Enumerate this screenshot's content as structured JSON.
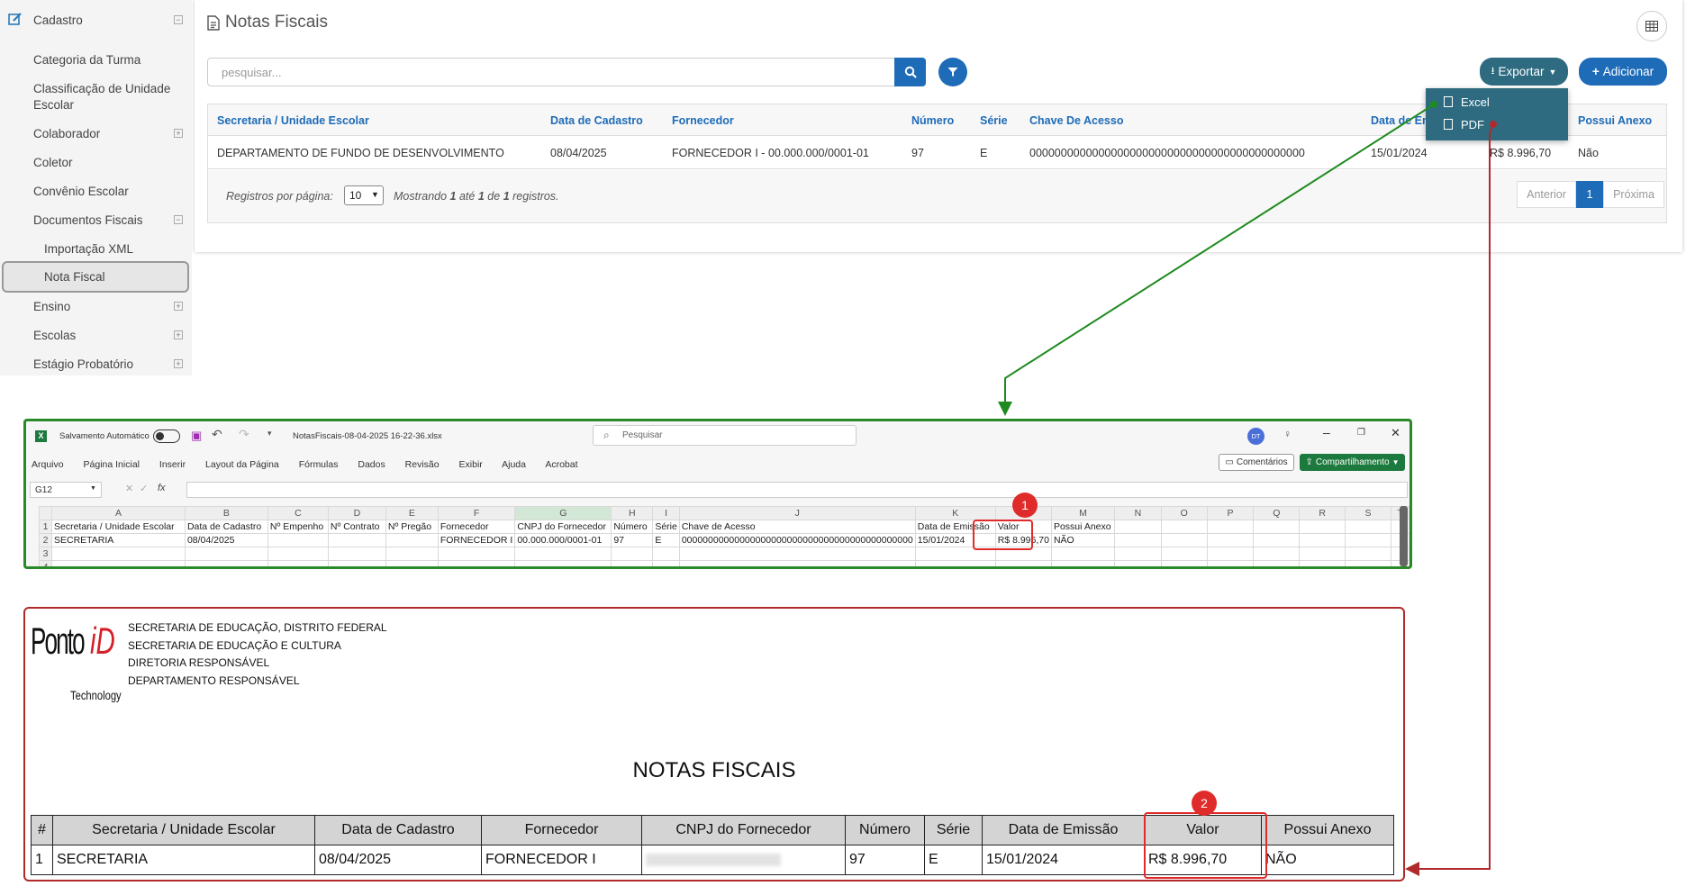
{
  "sidebar": {
    "header": "Cadastro",
    "items": [
      {
        "label": "Categoria da Turma"
      },
      {
        "label": "Classificação de Unidade"
      },
      {
        "label": "Escolar"
      },
      {
        "label": "Colaborador"
      },
      {
        "label": "Coletor"
      },
      {
        "label": "Convênio Escolar"
      },
      {
        "label": "Documentos Fiscais"
      },
      {
        "label": "Importação XML"
      },
      {
        "label": "Nota Fiscal"
      },
      {
        "label": "Ensino"
      },
      {
        "label": "Escolas"
      },
      {
        "label": "Estágio Probatório"
      }
    ]
  },
  "page": {
    "title": "Notas Fiscais",
    "search_placeholder": "pesquisar...",
    "export_label": "Exportar",
    "add_label": "Adicionar",
    "export_menu": [
      "Excel",
      "PDF"
    ]
  },
  "table": {
    "headers": [
      "Secretaria / Unidade Escolar",
      "Data de Cadastro",
      "Fornecedor",
      "Número",
      "Série",
      "Chave De Acesso",
      "Data de Em",
      "Possui Anexo"
    ],
    "row": [
      "DEPARTAMENTO DE FUNDO DE DESENVOLVIMENTO",
      "08/04/2025",
      "FORNECEDOR I - 00.000.000/0001-01",
      "97",
      "E",
      "00000000000000000000000000000000000000000000",
      "15/01/2024",
      "R$ 8.996,70",
      "Não"
    ],
    "footer": {
      "per_page_label": "Registros por página:",
      "per_page_value": "10",
      "showing_a": "Mostrando",
      "n1": "1",
      "showing_b": "até",
      "n2": "1",
      "showing_c": "de",
      "n3": "1",
      "showing_d": "registros."
    },
    "pagination": [
      "Anterior",
      "1",
      "Próxima"
    ]
  },
  "excel": {
    "autosave": "Salvamento Automático",
    "filename": "NotasFiscais-08-04-2025 16-22-36.xlsx",
    "search": "Pesquisar",
    "avatar": "DT",
    "menu": [
      "Arquivo",
      "Página Inicial",
      "Inserir",
      "Layout da Página",
      "Fórmulas",
      "Dados",
      "Revisão",
      "Exibir",
      "Ajuda",
      "Acrobat"
    ],
    "comments": "Comentários",
    "share": "Compartilhamento",
    "cellref": "G12",
    "fx": "fx",
    "cols": [
      "A",
      "B",
      "C",
      "D",
      "E",
      "F",
      "G",
      "H",
      "I",
      "J",
      "K",
      "L",
      "M",
      "N",
      "O",
      "P",
      "Q",
      "R",
      "S",
      "T"
    ],
    "header_row": [
      "Secretaria / Unidade Escolar",
      "Data de Cadastro",
      "Nº Empenho",
      "Nº Contrato",
      "Nº Pregão",
      "Fornecedor",
      "CNPJ do Fornecedor",
      "Número",
      "Série",
      "Chave de Acesso",
      "Data de Emissão",
      "Valor",
      "Possui Anexo"
    ],
    "data_row": [
      "SECRETARIA",
      "08/04/2025",
      "",
      "",
      "",
      "FORNECEDOR I",
      "00.000.000/0001-01",
      "97",
      "E",
      "00000000000000000000000000000000000000000000",
      "15/01/2024",
      "R$ 8.996,70",
      "NÃO"
    ],
    "badge": "1"
  },
  "pdf": {
    "logo_main": "Ponto",
    "logo_id": "iD",
    "logo_sub": "Technology",
    "header_lines": [
      "SECRETARIA DE EDUCAÇÃO, DISTRITO FEDERAL",
      "SECRETARIA DE EDUCAÇÃO E CULTURA",
      "DIRETORIA RESPONSÁVEL",
      "DEPARTAMENTO RESPONSÁVEL"
    ],
    "title": "NOTAS FISCAIS",
    "headers": [
      "#",
      "Secretaria / Unidade Escolar",
      "Data de Cadastro",
      "Fornecedor",
      "CNPJ do Fornecedor",
      "Número",
      "Série",
      "Data de Emissão",
      "Valor",
      "Possui Anexo"
    ],
    "row": [
      "1",
      "SECRETARIA",
      "08/04/2025",
      "FORNECEDOR I",
      "",
      "97",
      "E",
      "15/01/2024",
      "R$ 8.996,70",
      "NÃO"
    ],
    "badge": "2"
  }
}
